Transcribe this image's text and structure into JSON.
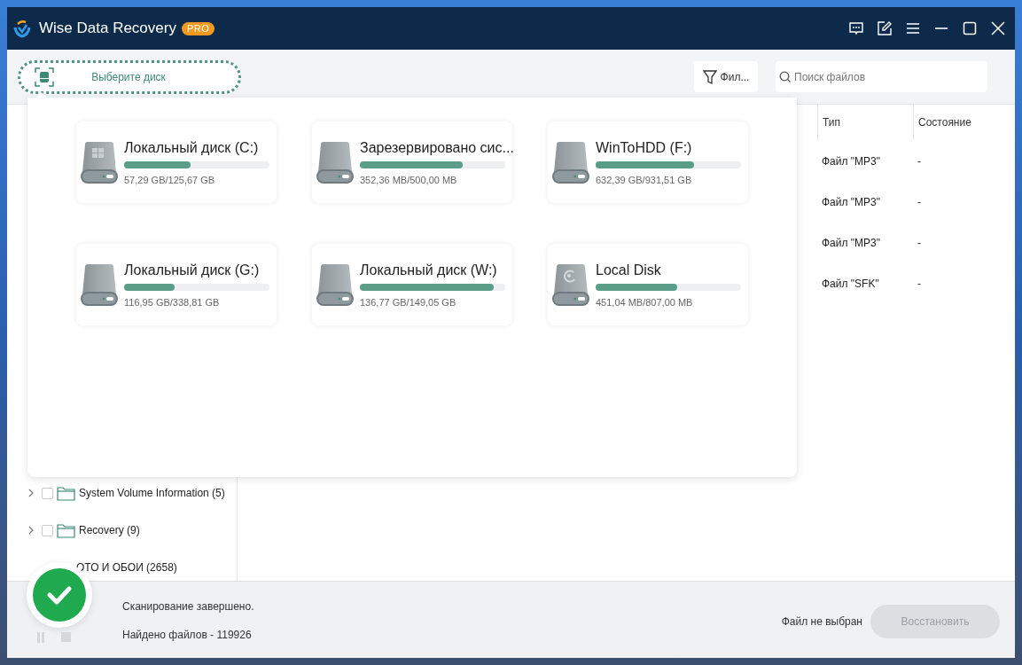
{
  "window": {
    "title": "Wise Data Recovery",
    "badge": "PRO"
  },
  "toolbar": {
    "select_disk": "Выберите диск",
    "filter": "Фил...",
    "search": {
      "placeholder": "Поиск файлов"
    }
  },
  "tree": [
    {
      "label": "System Volume Information (5)",
      "expanded": false,
      "checked": false
    },
    {
      "label": "Recovery (9)",
      "expanded": false,
      "checked": false
    },
    {
      "label": "ОТО И ОБОИ (2658)"
    }
  ],
  "table": {
    "columns": [
      "Тип",
      "Состояние"
    ],
    "rows": [
      {
        "type": "Файл \"MP3\"",
        "state": "-"
      },
      {
        "type": "Файл \"MP3\"",
        "state": "-"
      },
      {
        "type": "Файл \"MP3\"",
        "state": "-"
      },
      {
        "type": "Файл \"SFK\"",
        "state": "-"
      }
    ]
  },
  "drives": [
    {
      "kind": "system",
      "name": "Локальный диск (C:)",
      "level": 0.456,
      "size": "57,29 GB/125,67 GB"
    },
    {
      "kind": "plain",
      "name": "Зарезервировано сис...",
      "level": 0.705,
      "size": "352,36 MB/500,00 MB"
    },
    {
      "kind": "plain",
      "name": "WinToHDD (F:)",
      "level": 0.679,
      "size": "632,39 GB/931,51 GB"
    },
    {
      "kind": "plain",
      "name": "Локальный диск (G:)",
      "level": 0.345,
      "size": "116,95 GB/338,81 GB"
    },
    {
      "kind": "plain",
      "name": "Локальный диск (W:)",
      "level": 0.918,
      "size": "136,77 GB/149,05 GB"
    },
    {
      "kind": "recovery",
      "name": "Local Disk",
      "level": 0.559,
      "size": "451,04 MB/807,00 MB"
    }
  ],
  "status_bar": {
    "scan_done": true,
    "message": "Сканирование завершено.",
    "found": "Найдено файлов - 119926",
    "selection": "Файл не выбран",
    "restore": {
      "label": "Восстановить",
      "disabled": true
    }
  }
}
